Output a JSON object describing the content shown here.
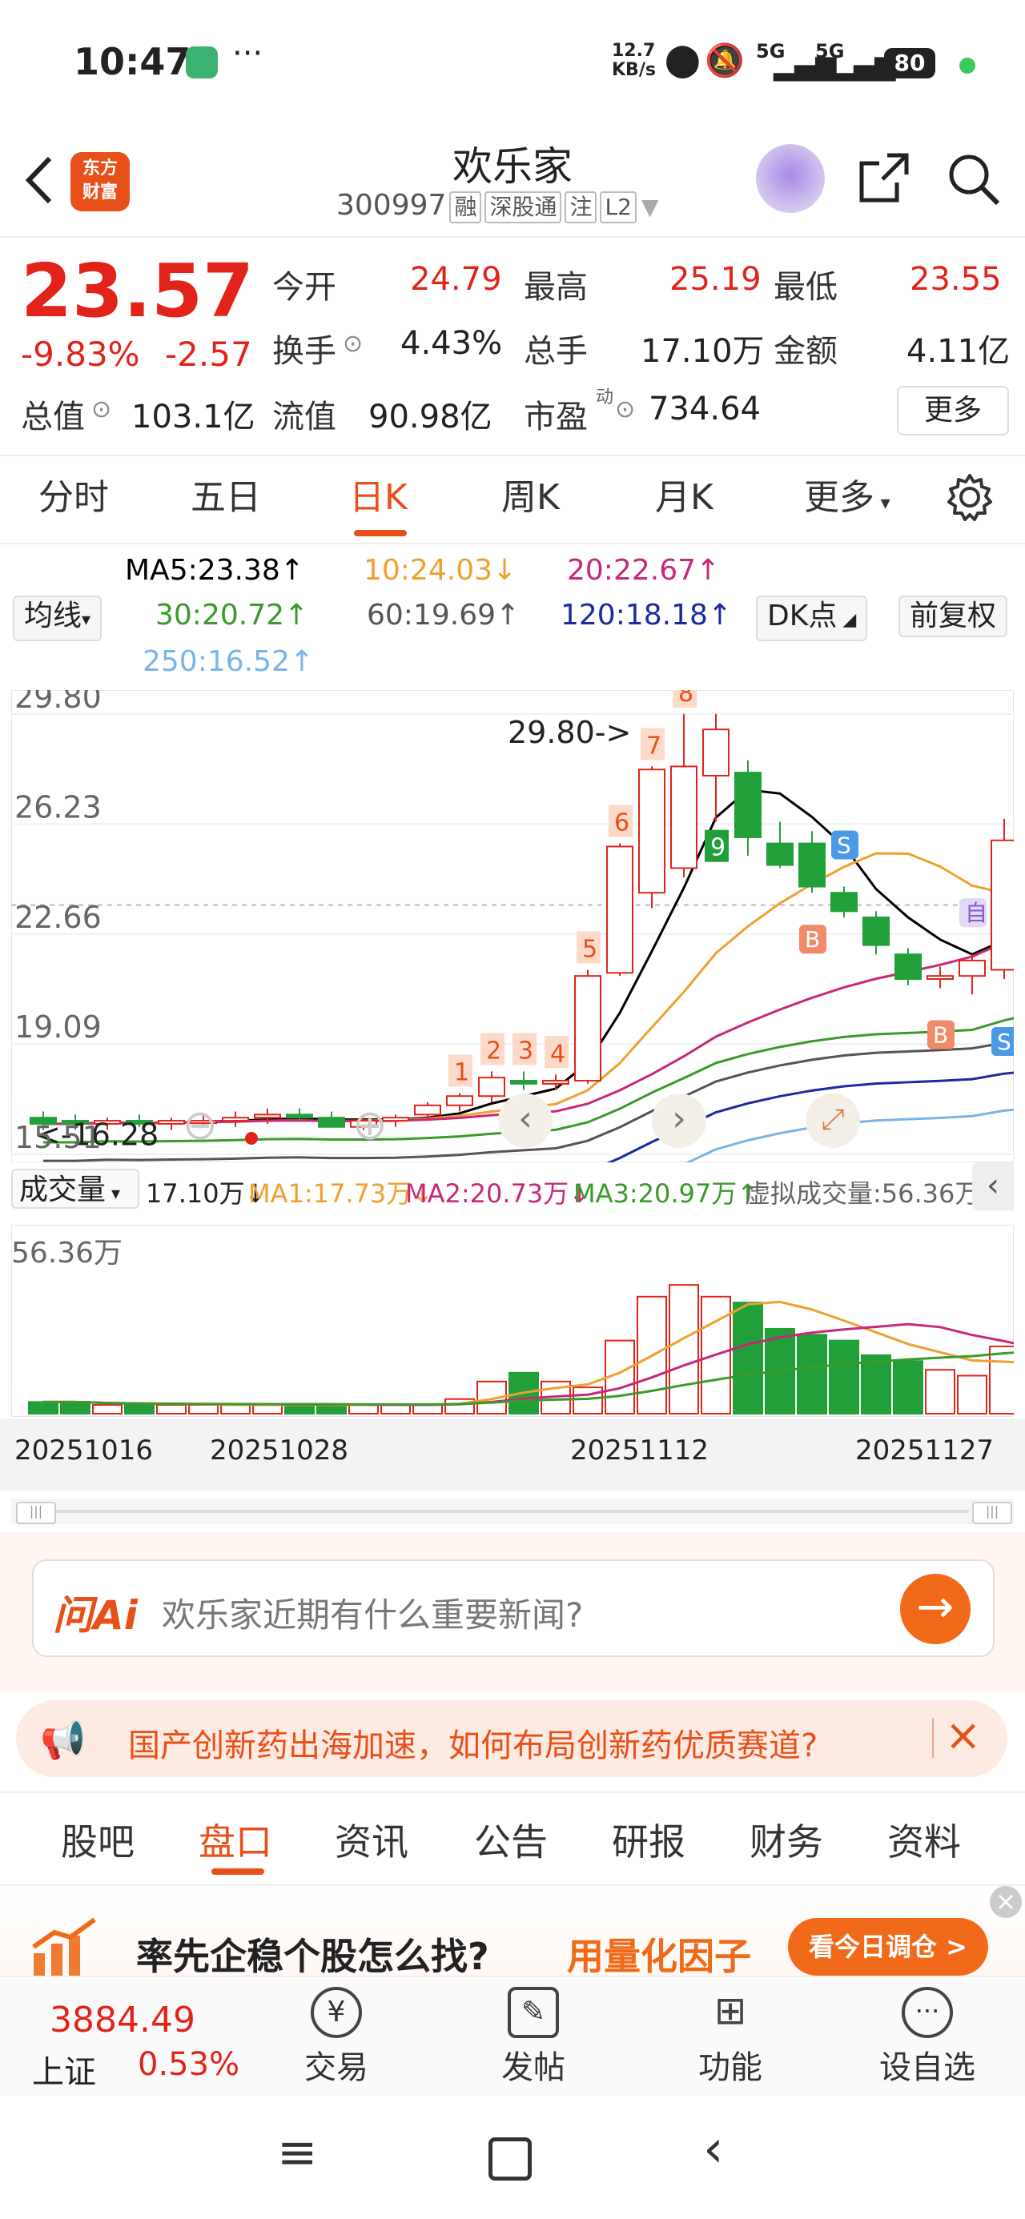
{
  "status": {
    "time": "10:47",
    "speed": "12.7",
    "speed_unit": "KB/s",
    "signal1": "5G",
    "signal2": "5G",
    "battery": "80"
  },
  "header": {
    "logo_line1": "东方",
    "logo_line2": "财富",
    "title": "欢乐家",
    "code": "300997",
    "tags": [
      "融",
      "深股通",
      "注",
      "L2"
    ]
  },
  "quote": {
    "price": "23.57",
    "change_pct": "-9.83%",
    "change": "-2.57",
    "open_label": "今开",
    "open": "24.79",
    "high_label": "最高",
    "high": "25.19",
    "low_label": "最低",
    "low": "23.55",
    "turnover_label": "换手",
    "turnover": "4.43%",
    "volume_label": "总手",
    "volume": "17.10万",
    "amount_label": "金额",
    "amount": "4.11亿",
    "mktcap_label": "总值",
    "mktcap": "103.1亿",
    "float_label": "流值",
    "float": "90.98亿",
    "pe_label": "市盈",
    "pe_sup": "动",
    "pe": "734.64",
    "more": "更多"
  },
  "tabs": [
    "分时",
    "五日",
    "日K",
    "周K",
    "月K",
    "更多"
  ],
  "active_tab": "日K",
  "ma": {
    "ma5": "MA5:23.38↑",
    "ma10": "10:24.03↓",
    "ma20": "20:22.67↑",
    "ma30": "30:20.72↑",
    "ma60": "60:19.69↑",
    "ma120": "120:18.18↑",
    "ma250": "250:16.52↑",
    "ma_select": "均线",
    "dk": "DK点",
    "adjust": "前复权"
  },
  "chart_data": {
    "type": "candlestick",
    "y_ticks": [
      "29.80",
      "26.23",
      "22.66",
      "19.09",
      "15.51"
    ],
    "ylim": [
      15.51,
      29.8
    ],
    "max_label": "29.80->",
    "min_label": "<-16.28",
    "x_ticks": [
      "20251016",
      "20251028",
      "20251112",
      "20251127"
    ],
    "candles": [
      {
        "o": 16.7,
        "h": 16.9,
        "l": 16.3,
        "c": 16.5
      },
      {
        "o": 16.6,
        "h": 16.8,
        "l": 16.3,
        "c": 16.5
      },
      {
        "o": 16.5,
        "h": 16.7,
        "l": 16.3,
        "c": 16.6
      },
      {
        "o": 16.6,
        "h": 16.8,
        "l": 16.4,
        "c": 16.5
      },
      {
        "o": 16.5,
        "h": 16.7,
        "l": 16.3,
        "c": 16.6
      },
      {
        "o": 16.6,
        "h": 16.8,
        "l": 16.4,
        "c": 16.6
      },
      {
        "o": 16.6,
        "h": 16.9,
        "l": 16.4,
        "c": 16.7
      },
      {
        "o": 16.7,
        "h": 17.0,
        "l": 16.5,
        "c": 16.8
      },
      {
        "o": 16.8,
        "h": 17.0,
        "l": 16.6,
        "c": 16.7
      },
      {
        "o": 16.7,
        "h": 16.9,
        "l": 16.5,
        "c": 16.4
      },
      {
        "o": 16.4,
        "h": 16.7,
        "l": 16.3,
        "c": 16.6
      },
      {
        "o": 16.6,
        "h": 16.8,
        "l": 16.4,
        "c": 16.7
      },
      {
        "o": 16.8,
        "h": 17.2,
        "l": 16.6,
        "c": 17.1
      },
      {
        "o": 17.1,
        "h": 17.5,
        "l": 16.9,
        "c": 17.4
      },
      {
        "o": 17.4,
        "h": 18.2,
        "l": 17.2,
        "c": 18.0
      },
      {
        "o": 17.9,
        "h": 18.2,
        "l": 17.6,
        "c": 17.8
      },
      {
        "o": 17.8,
        "h": 18.1,
        "l": 17.6,
        "c": 17.9
      },
      {
        "o": 17.9,
        "h": 21.5,
        "l": 17.8,
        "c": 21.3
      },
      {
        "o": 21.4,
        "h": 25.6,
        "l": 21.3,
        "c": 25.5
      },
      {
        "o": 24.0,
        "h": 28.1,
        "l": 23.5,
        "c": 28.0
      },
      {
        "o": 24.8,
        "h": 29.8,
        "l": 24.5,
        "c": 28.1
      },
      {
        "o": 27.8,
        "h": 29.8,
        "l": 26.3,
        "c": 29.3
      },
      {
        "o": 27.9,
        "h": 28.3,
        "l": 25.2,
        "c": 25.8
      },
      {
        "o": 25.6,
        "h": 26.3,
        "l": 24.8,
        "c": 24.9
      },
      {
        "o": 25.6,
        "h": 26.0,
        "l": 24.0,
        "c": 24.2
      },
      {
        "o": 24.0,
        "h": 24.2,
        "l": 23.2,
        "c": 23.4
      },
      {
        "o": 23.2,
        "h": 23.4,
        "l": 22.0,
        "c": 22.3
      },
      {
        "o": 22.0,
        "h": 22.2,
        "l": 21.0,
        "c": 21.2
      },
      {
        "o": 21.2,
        "h": 21.6,
        "l": 20.9,
        "c": 21.3
      },
      {
        "o": 21.3,
        "h": 22.0,
        "l": 20.7,
        "c": 21.8
      },
      {
        "o": 21.5,
        "h": 26.4,
        "l": 21.2,
        "c": 25.7
      },
      {
        "o": 24.6,
        "h": 25.2,
        "l": 23.6,
        "c": 23.6
      }
    ],
    "nine_labels": [
      "1",
      "2",
      "3",
      "4",
      "5",
      "6",
      "7",
      "8",
      "9"
    ],
    "signals": [
      {
        "text": "S"
      },
      {
        "text": "B"
      },
      {
        "text": "自"
      },
      {
        "text": "B"
      },
      {
        "text": "S"
      },
      {
        "text": "B"
      }
    ],
    "volume": {
      "label": "成交量",
      "value": "17.10万↓",
      "ma1": "MA1:17.73万↓",
      "ma2": "MA2:20.73万↓",
      "ma3": "MA3:20.97万↑",
      "virtual": "虚拟成交量:56.36万",
      "max_label": "56.36万",
      "values": [
        4,
        4,
        3,
        3,
        3,
        3,
        3,
        3,
        3,
        3,
        3,
        3,
        3,
        5,
        11,
        14,
        11,
        9,
        25,
        40,
        44,
        40,
        38,
        29,
        27,
        25,
        20,
        18,
        15,
        13,
        23,
        17
      ]
    }
  },
  "ai": {
    "logo": "问Ai",
    "placeholder": "欢乐家近期有什么重要新闻?"
  },
  "banner": {
    "text": "国产创新药出海加速，如何布局创新药优质赛道?"
  },
  "subtabs": [
    "股吧",
    "盘口",
    "资讯",
    "公告",
    "研报",
    "财务",
    "资料"
  ],
  "active_subtab": "盘口",
  "promo": {
    "text1": "率先企稳个股怎么找?",
    "text2": "用量化因子",
    "button": "看今日调仓 >"
  },
  "bottom": {
    "index_value": "3884.49",
    "index_name": "上证",
    "index_change": "0.53%",
    "items": [
      "交易",
      "发帖",
      "功能",
      "设自选"
    ]
  },
  "colors": {
    "up": "#e2231a",
    "down": "#21a03a",
    "accent": "#e8501a",
    "ma5": "#000000",
    "ma10": "#f0a030",
    "ma20": "#c8287a",
    "ma30": "#3a9a2a",
    "ma60": "#555555",
    "ma120": "#1a2aa0",
    "ma250": "#7ab4e6"
  }
}
